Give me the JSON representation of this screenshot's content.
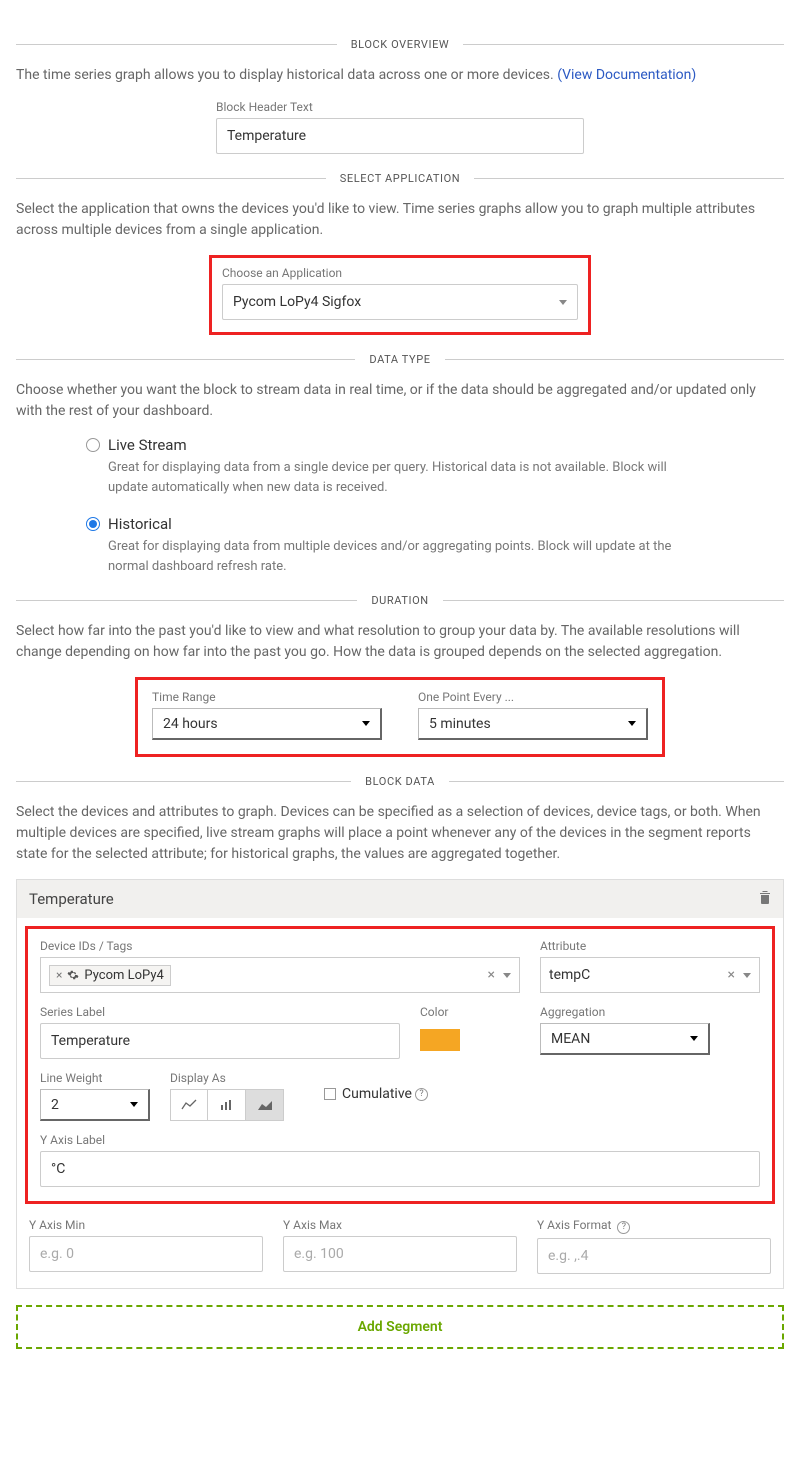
{
  "sections": {
    "overview": {
      "title": "BLOCK OVERVIEW",
      "desc": "The time series graph allows you to display historical data across one or more devices.",
      "doc_link": "(View Documentation)",
      "header_label": "Block Header Text",
      "header_value": "Temperature"
    },
    "application": {
      "title": "SELECT APPLICATION",
      "desc": "Select the application that owns the devices you'd like to view. Time series graphs allow you to graph multiple attributes across multiple devices from a single application.",
      "choose_label": "Choose an Application",
      "value": "Pycom LoPy4 Sigfox"
    },
    "datatype": {
      "title": "DATA TYPE",
      "desc": "Choose whether you want the block to stream data in real time, or if the data should be aggregated and/or updated only with the rest of your dashboard.",
      "options": [
        {
          "label": "Live Stream",
          "desc": "Great for displaying data from a single device per query. Historical data is not available. Block will update automatically when new data is received.",
          "checked": false
        },
        {
          "label": "Historical",
          "desc": "Great for displaying data from multiple devices and/or aggregating points. Block will update at the normal dashboard refresh rate.",
          "checked": true
        }
      ]
    },
    "duration": {
      "title": "DURATION",
      "desc": "Select how far into the past you'd like to view and what resolution to group your data by. The available resolutions will change depending on how far into the past you go. How the data is grouped depends on the selected aggregation.",
      "time_range_label": "Time Range",
      "time_range_value": "24 hours",
      "resolution_label": "One Point Every ...",
      "resolution_value": "5 minutes"
    },
    "blockdata": {
      "title": "BLOCK DATA",
      "desc": "Select the devices and attributes to graph. Devices can be specified as a selection of devices, device tags, or both. When multiple devices are specified, live stream graphs will place a point whenever any of the devices in the segment reports state for the selected attribute; for historical graphs, the values are aggregated together.",
      "segment": {
        "name": "Temperature",
        "device_label": "Device IDs / Tags",
        "device_value": "Pycom LoPy4",
        "attribute_label": "Attribute",
        "attribute_value": "tempC",
        "series_label_label": "Series Label",
        "series_label_value": "Temperature",
        "color_label": "Color",
        "color_value": "#f5a623",
        "aggregation_label": "Aggregation",
        "aggregation_value": "MEAN",
        "line_weight_label": "Line Weight",
        "line_weight_value": "2",
        "display_as_label": "Display As",
        "cumulative_label": "Cumulative",
        "y_axis_label_label": "Y Axis Label",
        "y_axis_label_value": "°C",
        "y_min_label": "Y Axis Min",
        "y_min_placeholder": "e.g. 0",
        "y_max_label": "Y Axis Max",
        "y_max_placeholder": "e.g. 100",
        "y_format_label": "Y Axis Format",
        "y_format_placeholder": "e.g. ,.4"
      },
      "add_segment": "Add Segment"
    }
  }
}
